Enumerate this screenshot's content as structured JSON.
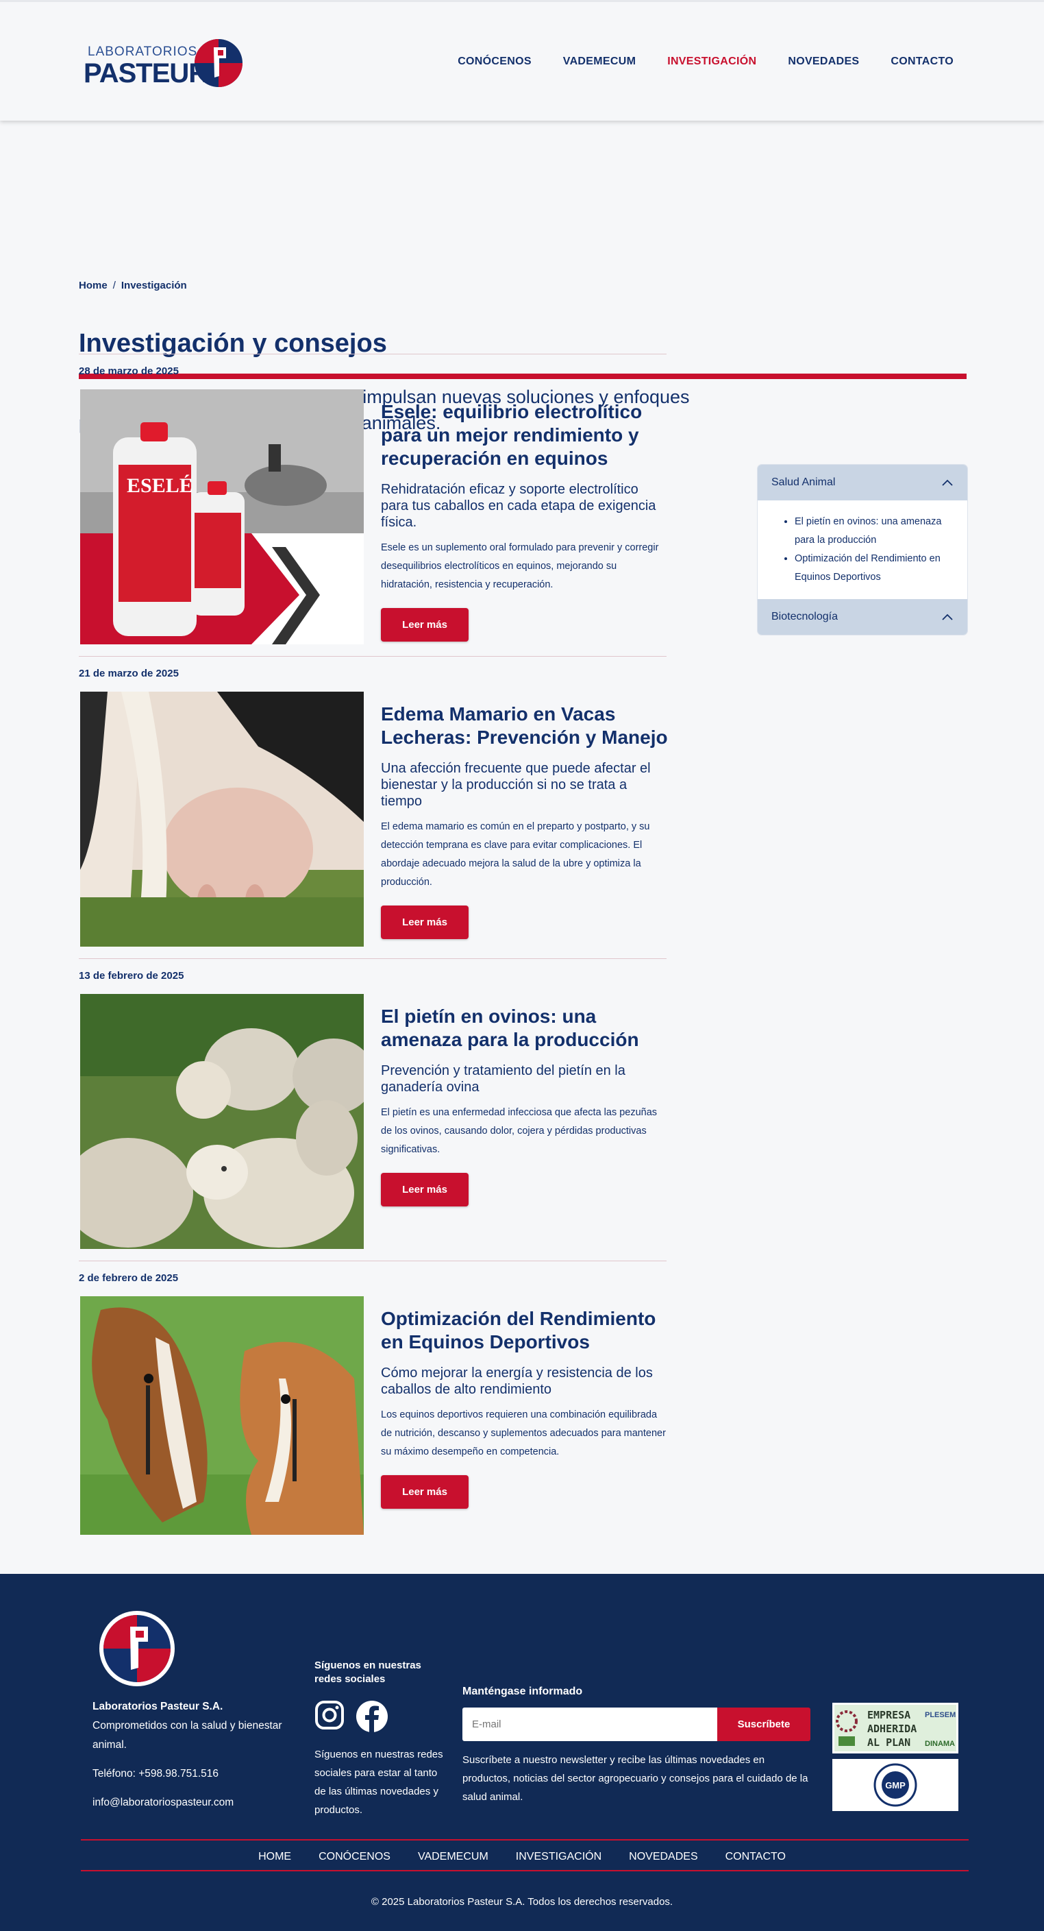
{
  "brand": {
    "logo_small": "LABORATORIOS",
    "logo_big": "PASTEUR"
  },
  "nav": {
    "items": [
      "CONÓCENOS",
      "VADEMECUM",
      "INVESTIGACIÓN",
      "NOVEDADES",
      "CONTACTO"
    ],
    "active": "INVESTIGACIÓN"
  },
  "breadcrumb": {
    "home": "Home",
    "separator": "/",
    "current": "Investigación"
  },
  "page": {
    "title": "Investigación y consejos",
    "intro": "Explora investigaciones clave que impulsan nuevas soluciones y enfoques para el bienestar y cuidado de tus animales."
  },
  "articles": [
    {
      "date": "28 de marzo de 2025",
      "title": "Esele: equilibrio electrolítico para un mejor rendimiento y recuperación en equinos",
      "subtitle": "Rehidratación eficaz y soporte electrolítico para tus caballos en cada etapa de exigencia física.",
      "body": "Esele es un suplemento oral formulado para prevenir y corregir desequilibrios electrolíticos en equinos, mejorando su hidratación, resistencia y recuperación.",
      "button": "Leer más",
      "image_label": "ESELÉ"
    },
    {
      "date": "21 de marzo de 2025",
      "title": "Edema Mamario en Vacas Lecheras: Prevención y Manejo",
      "subtitle": "Una afección frecuente que puede afectar el bienestar y la producción si no se trata a tiempo",
      "body": "El edema mamario es común en el preparto y postparto, y su detección temprana es clave para evitar complicaciones. El abordaje adecuado mejora la salud de la ubre y optimiza la producción.",
      "button": "Leer más"
    },
    {
      "date": "13 de febrero de 2025",
      "title": "El pietín en ovinos: una amenaza para la producción",
      "subtitle": "Prevención y tratamiento del pietín en la ganadería ovina",
      "body": "El pietín es una enfermedad infecciosa que afecta las pezuñas de los ovinos, causando dolor, cojera y pérdidas productivas significativas.",
      "button": "Leer más"
    },
    {
      "date": "2 de febrero de 2025",
      "title": "Optimización del Rendimiento en Equinos Deportivos",
      "subtitle": "Cómo mejorar la energía y resistencia de los caballos de alto rendimiento",
      "body": "Los equinos deportivos requieren una combinación equilibrada de nutrición, descanso y suplementos adecuados para mantener su máximo desempeño en competencia.",
      "button": "Leer más"
    }
  ],
  "sidebar": {
    "sections": [
      {
        "title": "Salud Animal",
        "items": [
          "El pietín en ovinos: una amenaza para la producción",
          "Optimización del Rendimiento en Equinos Deportivos"
        ]
      },
      {
        "title": "Biotecnología",
        "items": []
      }
    ]
  },
  "footer": {
    "company_name": "Laboratorios Pasteur S.A.",
    "company_tagline": "Comprometidos con la salud y bienestar animal.",
    "phone": "Teléfono: +598.98.751.516",
    "email": "info@laboratoriospasteur.com",
    "social_title": "Síguenos en nuestras redes sociales",
    "social_desc": "Síguenos en nuestras redes sociales para estar al tanto de las últimas novedades y productos.",
    "newsletter_title": "Manténgase informado",
    "newsletter_placeholder": "E-mail",
    "newsletter_button": "Suscríbete",
    "newsletter_desc": "Suscríbete a nuestro newsletter y recibe las últimas novedades en productos, noticias del sector agropecuario y consejos para el cuidado de la salud animal.",
    "badge1_lines": [
      "EMPRESA",
      "ADHERIDA",
      "AL PLAN"
    ],
    "badge1_side": [
      "PLESEM",
      "DINAMA"
    ],
    "badge2_text": "GMP",
    "nav": [
      "HOME",
      "CONÓCENOS",
      "VADEMECUM",
      "INVESTIGACIÓN",
      "NOVEDADES",
      "CONTACTO"
    ],
    "copyright": "© 2025 Laboratorios Pasteur S.A. Todos los derechos reservados."
  },
  "colors": {
    "primary": "#13306b",
    "accent": "#c8102e",
    "footer_bg": "#112a55",
    "page_bg": "#f6f7f9"
  }
}
